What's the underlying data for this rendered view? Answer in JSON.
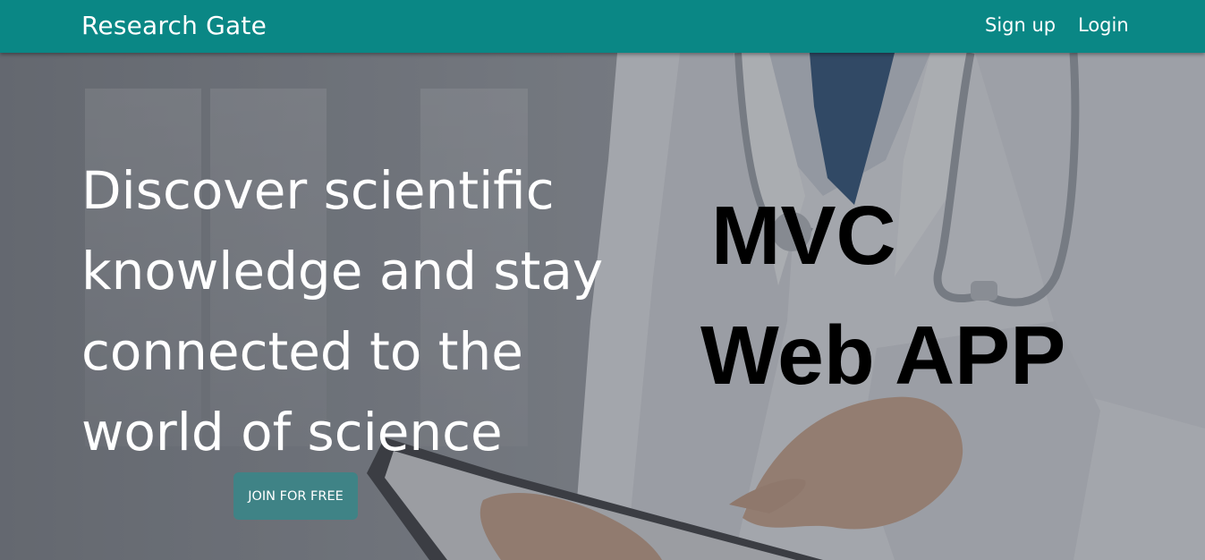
{
  "navbar": {
    "brand": "Research Gate",
    "links": [
      {
        "label": "Sign up"
      },
      {
        "label": "Login"
      }
    ],
    "background_color": "#0a8785"
  },
  "hero": {
    "headline_lines": [
      "Discover scientific",
      "knowledge and stay",
      "connected to the",
      "world of science"
    ],
    "cta_label": "JOIN FOR FREE",
    "cta_color": "#3f8386"
  },
  "overlay": {
    "title_lines": [
      "MVC",
      "Web APP"
    ]
  }
}
